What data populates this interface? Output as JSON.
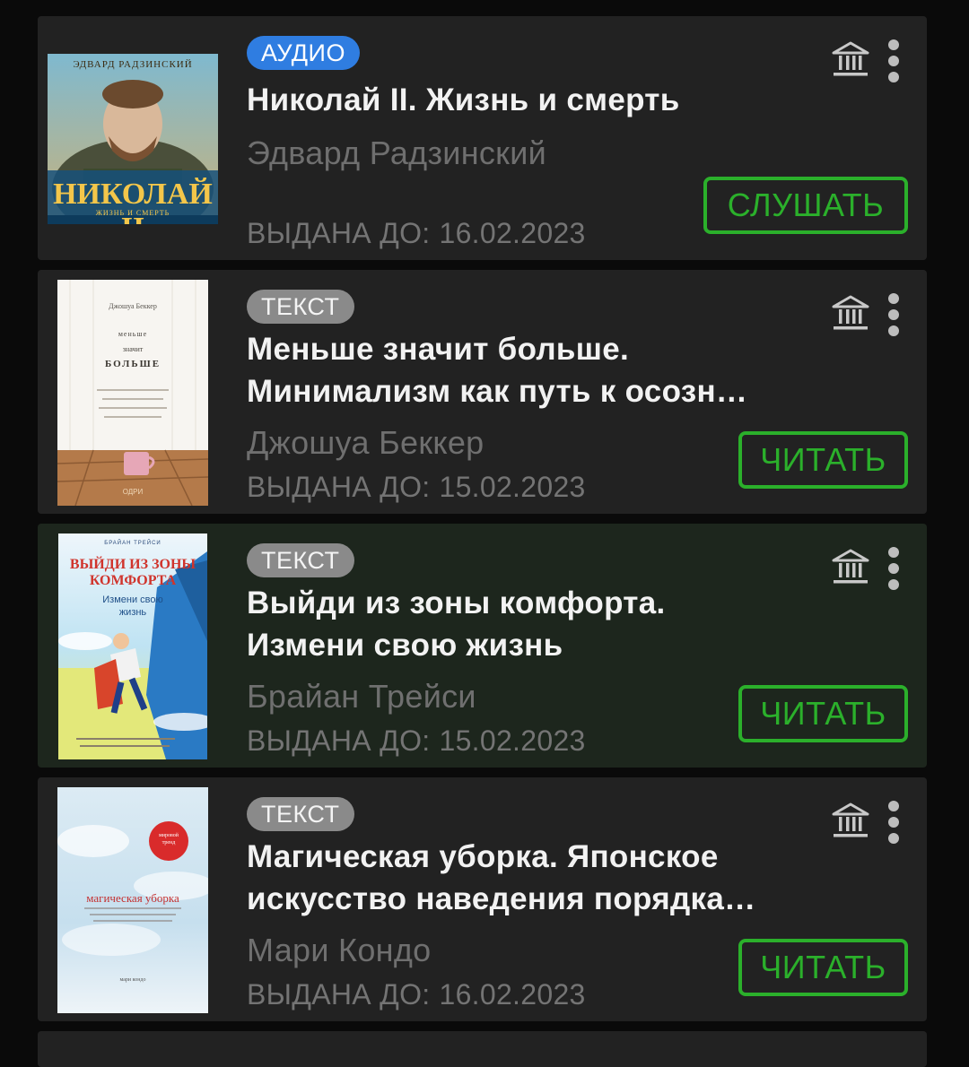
{
  "books": [
    {
      "format": "АУДИО",
      "title": "Николай II. Жизнь и смерть",
      "author": "Эдвард Радзинский",
      "issued_label": "ВЫДАНА ДО:",
      "issued_date": "16.02.2023",
      "action": "СЛУШАТЬ",
      "cover": {
        "top_text": "ЭДВАРД РАДЗИНСКИЙ",
        "main_text": "НИКОЛАЙ II",
        "sub_text": "ЖИЗНЬ И СМЕРТЬ"
      }
    },
    {
      "format": "ТЕКСТ",
      "title": "Меньше значит больше.\nМинимализм как путь к осозн…",
      "author": "Джошуа Беккер",
      "issued_label": "ВЫДАНА ДО:",
      "issued_date": "15.02.2023",
      "action": "ЧИТАТЬ",
      "cover": {
        "top_text": "Джошуа Беккер",
        "line1": "меньше",
        "line2": "значит",
        "line3": "БОЛЬШЕ",
        "publisher": "ОДРИ"
      }
    },
    {
      "format": "ТЕКСТ",
      "title": "Выйди из зоны комфорта.\nИзмени свою жизнь",
      "author": "Брайан Трейси",
      "issued_label": "ВЫДАНА ДО:",
      "issued_date": "15.02.2023",
      "action": "ЧИТАТЬ",
      "cover": {
        "top_text": "БРАЙАН ТРЕЙСИ",
        "line1": "ВЫЙДИ ИЗ ЗОНЫ",
        "line2": "КОМФОРТА",
        "line3": "Измени свою",
        "line4": "жизнь"
      }
    },
    {
      "format": "ТЕКСТ",
      "title": "Магическая уборка. Японское\nискусство наведения порядка…",
      "author": "Мари Кондо",
      "issued_label": "ВЫДАНА ДО:",
      "issued_date": "16.02.2023",
      "action": "ЧИТАТЬ",
      "cover": {
        "badge_line1": "мировой",
        "badge_line2": "тренд",
        "title_text": "магическая уборка",
        "author_text": "мари кондо"
      }
    }
  ],
  "colors": {
    "audio_badge": "#2f7de1",
    "text_badge": "#8a8a8a",
    "action_green": "#2bb02b",
    "card_bg": "#222222",
    "selected_card_bg": "#1d261d"
  },
  "icons": {
    "library": "library-building-icon",
    "menu": "more-vert-icon"
  }
}
